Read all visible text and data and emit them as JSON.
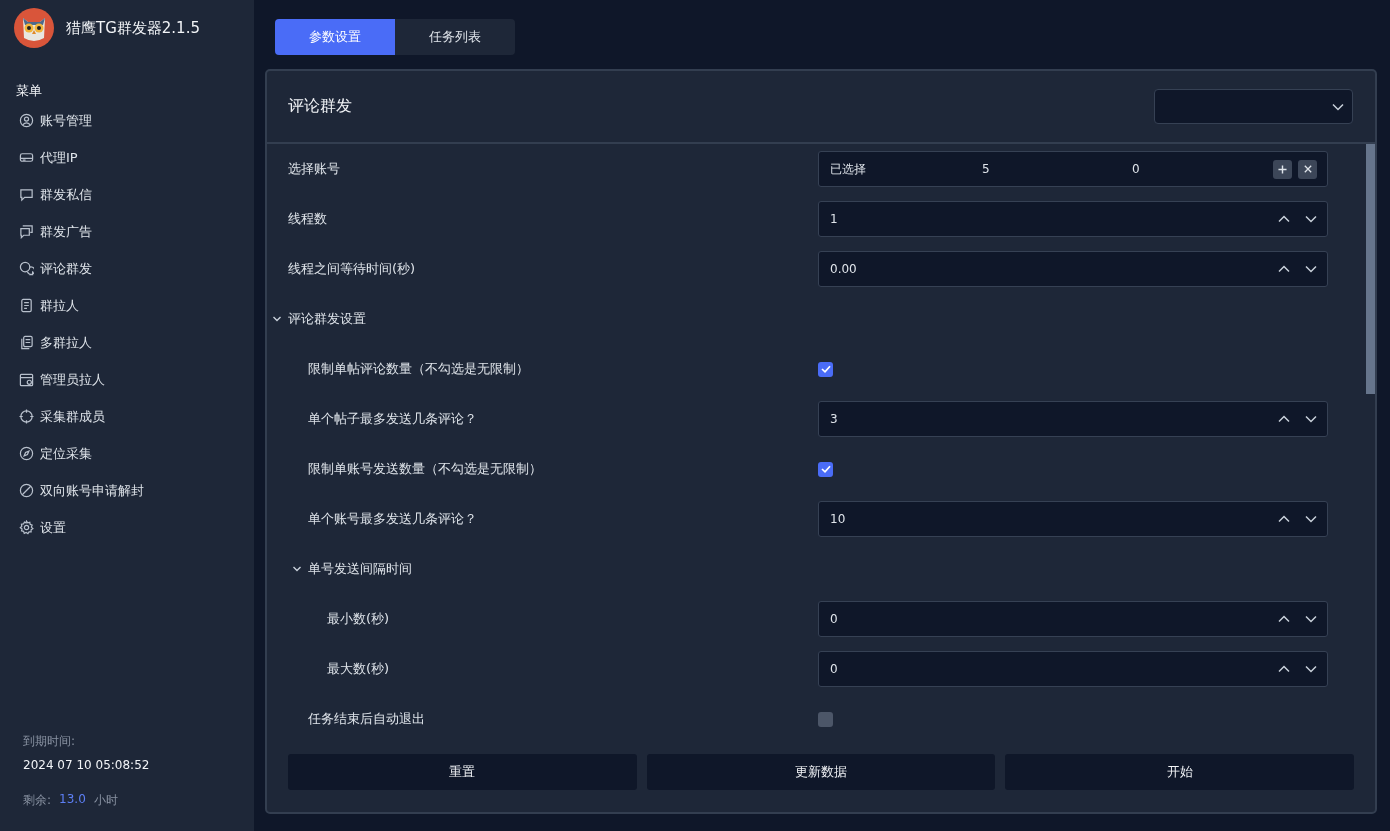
{
  "app": {
    "title": "猎鹰TG群发器2.1.5"
  },
  "sidebar": {
    "heading": "菜单",
    "items": [
      {
        "label": "账号管理"
      },
      {
        "label": "代理IP"
      },
      {
        "label": "群发私信"
      },
      {
        "label": "群发广告"
      },
      {
        "label": "评论群发"
      },
      {
        "label": "群拉人"
      },
      {
        "label": "多群拉人"
      },
      {
        "label": "管理员拉人"
      },
      {
        "label": "采集群成员"
      },
      {
        "label": "定位采集"
      },
      {
        "label": "双向账号申请解封"
      },
      {
        "label": "设置"
      }
    ]
  },
  "expiry": {
    "label": "到期时间:",
    "datetime": "2024 07 10 05:08:52",
    "remaining_label": "剩余:",
    "remaining_value": "13.0",
    "remaining_unit": "小时"
  },
  "tabs": [
    {
      "label": "参数设置",
      "selected": true
    },
    {
      "label": "任务列表",
      "selected": false
    }
  ],
  "panel": {
    "title": "评论群发"
  },
  "settings": [
    {
      "kind": "accounts",
      "label": "选择账号",
      "value_label": "已选择",
      "value_1": "5",
      "value_2": "0"
    },
    {
      "kind": "number",
      "label": "线程数",
      "value": "1"
    },
    {
      "kind": "number",
      "label": "线程之间等待时间(秒)",
      "value": "0.00"
    },
    {
      "kind": "group",
      "label": "评论群发设置",
      "expanded": true,
      "children": [
        {
          "kind": "checkbox",
          "label": "限制单帖评论数量（不勾选是无限制）",
          "checked": true
        },
        {
          "kind": "number",
          "label": "单个帖子最多发送几条评论？",
          "value": "3"
        },
        {
          "kind": "checkbox",
          "label": "限制单账号发送数量（不勾选是无限制）",
          "checked": true
        },
        {
          "kind": "number",
          "label": "单个账号最多发送几条评论？",
          "value": "10"
        },
        {
          "kind": "group",
          "label": "单号发送间隔时间",
          "expanded": true,
          "children": [
            {
              "kind": "number",
              "label": "最小数(秒)",
              "value": "0"
            },
            {
              "kind": "number",
              "label": "最大数(秒)",
              "value": "0"
            }
          ]
        },
        {
          "kind": "checkbox",
          "label": "任务结束后自动退出",
          "checked": false
        }
      ]
    }
  ],
  "buttons": [
    "重置",
    "更新数据",
    "开始"
  ]
}
